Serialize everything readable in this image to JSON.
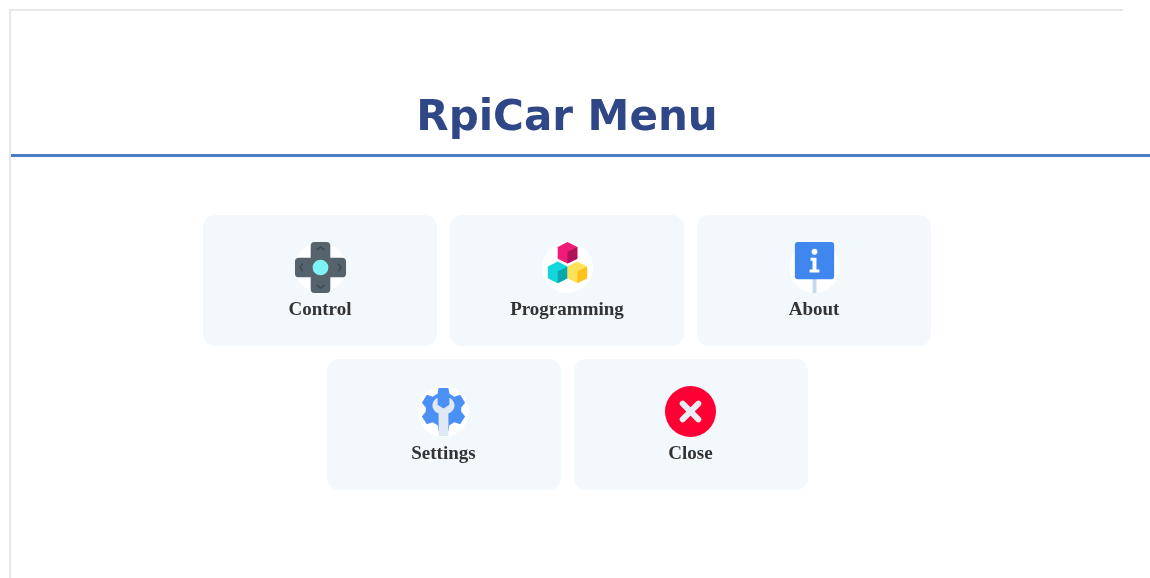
{
  "title": "RpiCar Menu",
  "menu_items": [
    {
      "label": "Control",
      "kind": "dpad"
    },
    {
      "label": "Programming",
      "kind": "cubes"
    },
    {
      "label": "About",
      "kind": "info"
    },
    {
      "label": "Settings",
      "kind": "gear"
    },
    {
      "label": "Close",
      "kind": "close"
    }
  ]
}
